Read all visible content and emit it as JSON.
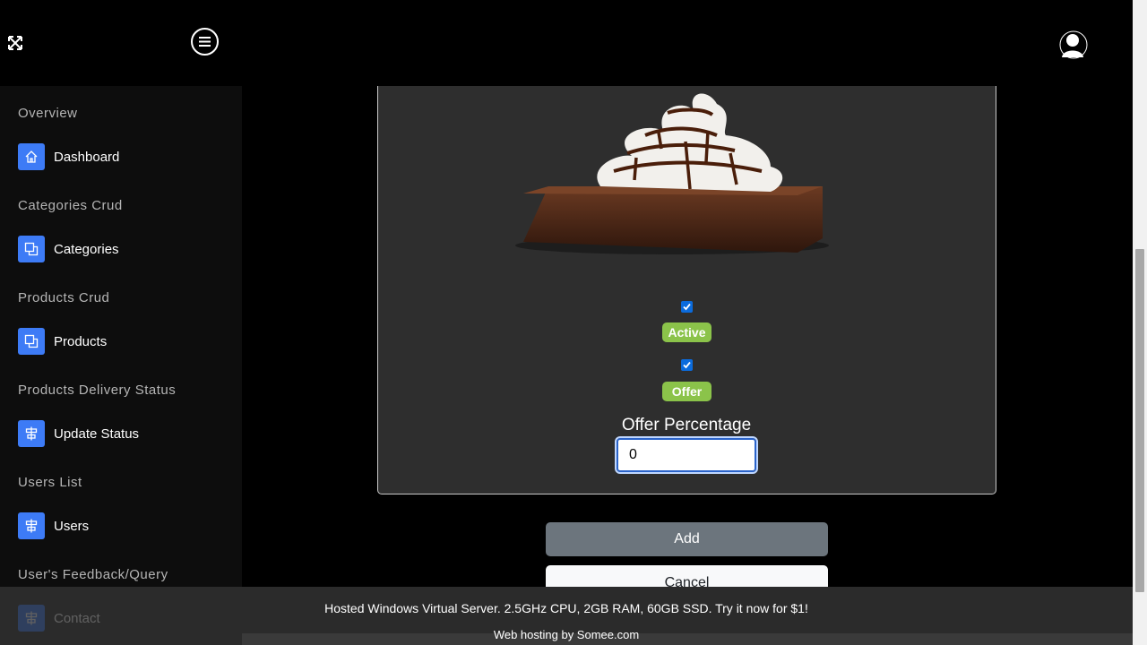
{
  "header": {
    "expand_icon": "expand-arrows-icon",
    "menu_icon": "hamburger-menu-icon",
    "avatar_icon": "user-avatar-icon"
  },
  "sidebar": {
    "sections": [
      {
        "title": "Overview",
        "item": {
          "label": "Dashboard",
          "icon": "home-icon"
        }
      },
      {
        "title": "Categories Crud",
        "item": {
          "label": "Categories",
          "icon": "windows-icon"
        }
      },
      {
        "title": "Products Crud",
        "item": {
          "label": "Products",
          "icon": "windows-icon"
        }
      },
      {
        "title": "Products Delivery Status",
        "item": {
          "label": "Update Status",
          "icon": "align-center-icon"
        }
      },
      {
        "title": "Users List",
        "item": {
          "label": "Users",
          "icon": "align-center-icon"
        }
      },
      {
        "title": "User's Feedback/Query",
        "item": {
          "label": "Contact",
          "icon": "align-center-icon"
        }
      }
    ]
  },
  "form": {
    "active_checked": true,
    "active_label": "Active",
    "offer_checked": true,
    "offer_label": "Offer",
    "offer_percentage_label": "Offer Percentage",
    "offer_percentage_value": "0",
    "add_label": "Add",
    "cancel_label": "Cancel"
  },
  "footer": {
    "ad_text": "Hosted Windows Virtual Server. 2.5GHz CPU, 2GB RAM, 60GB SSD. Try it now for $1!",
    "hosting_text": "Web hosting by Somee.com"
  },
  "colors": {
    "accent": "#3d7bf6",
    "badge": "#8bc34a",
    "add_button": "#6c757d"
  }
}
